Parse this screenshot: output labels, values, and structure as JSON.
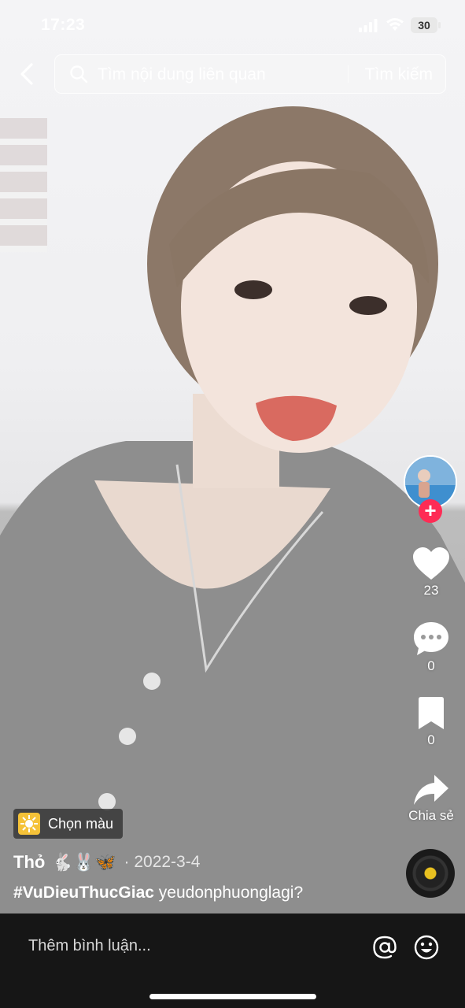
{
  "status_bar": {
    "time": "17:23",
    "battery": "30"
  },
  "search": {
    "placeholder": "Tìm nội dung liên quan",
    "submit_label": "Tìm kiếm"
  },
  "sidebar": {
    "likes": "23",
    "comments": "0",
    "saves": "0",
    "share_label": "Chia sẻ",
    "follow_symbol": "+"
  },
  "effect": {
    "label": "Chọn màu"
  },
  "post": {
    "author": "Thỏ",
    "author_emoji": "🐇🐰🦋",
    "date": "· 2022-3-4",
    "hashtag": "#VuDieuThucGiac",
    "caption": "yeudonphuonglagi?"
  },
  "comment_bar": {
    "placeholder": "Thêm bình luận..."
  },
  "colors": {
    "accent": "#fe2c55",
    "effect_icon": "#f5c238",
    "bar_bg": "#161616"
  }
}
